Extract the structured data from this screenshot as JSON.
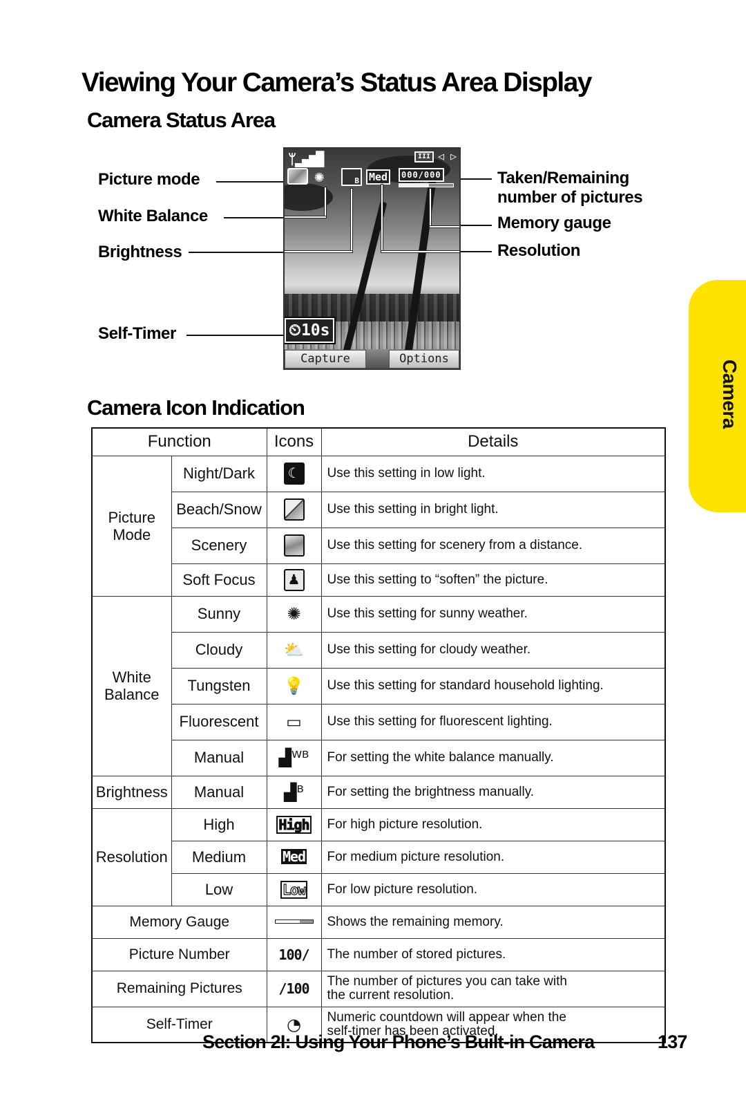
{
  "page": {
    "title": "Viewing Your Camera’s Status Area Display",
    "section_status_heading": "Camera Status Area",
    "section_icons_heading": "Camera Icon Indication",
    "side_tab": "Camera",
    "footer_section": "Section 2I: Using Your Phone’s Built-in Camera",
    "page_number": "137"
  },
  "status_area": {
    "left_callouts": [
      "Picture mode",
      "White Balance",
      "Brightness",
      "Self-Timer"
    ],
    "right_callouts": [
      "Taken/Remaining\nnumber of pictures",
      "Memory gauge",
      "Resolution"
    ],
    "taken_remaining_line1": "Taken/Remaining",
    "taken_remaining_line2": "number of pictures",
    "screen": {
      "signal_icon": "signal-strength-icon",
      "battery_icon": "battery-icon",
      "resolution_badge": "Med",
      "counter": "000/000",
      "timer": "10s",
      "softkey_left": "Capture",
      "softkey_right": "Options"
    }
  },
  "table": {
    "headers": [
      "Function",
      "Icons",
      "Details"
    ],
    "groups": {
      "picture_mode": "Picture\nMode",
      "picture_mode_l1": "Picture",
      "picture_mode_l2": "Mode",
      "white_balance_l1": "White",
      "white_balance_l2": "Balance",
      "brightness": "Brightness",
      "resolution": "Resolution"
    },
    "rows": [
      {
        "function": "Night/Dark",
        "icon": "night-mode-icon",
        "details": "Use this setting in low light."
      },
      {
        "function": "Beach/Snow",
        "icon": "beach-snow-icon",
        "details": "Use this setting in bright light."
      },
      {
        "function": "Scenery",
        "icon": "scenery-icon",
        "details": "Use this setting for scenery from a distance."
      },
      {
        "function": "Soft Focus",
        "icon": "soft-focus-icon",
        "details": "Use this setting to “soften” the picture."
      },
      {
        "function": "Sunny",
        "icon": "sunny-icon",
        "details": "Use this setting for sunny weather."
      },
      {
        "function": "Cloudy",
        "icon": "cloudy-icon",
        "details": "Use this setting for cloudy weather."
      },
      {
        "function": "Tungsten",
        "icon": "tungsten-bulb-icon",
        "details": "Use this setting for standard household lighting."
      },
      {
        "function": "Fluorescent",
        "icon": "fluorescent-icon",
        "details": "Use this setting for fluorescent lighting."
      },
      {
        "function": "Manual",
        "icon": "manual-white-balance-icon",
        "details": "For setting the white balance manually."
      },
      {
        "function": "Manual",
        "icon": "manual-brightness-icon",
        "details": "For setting the brightness manually."
      },
      {
        "function": "High",
        "icon": "high-resolution-icon",
        "icon_text": "High",
        "details": "For high picture resolution."
      },
      {
        "function": "Medium",
        "icon": "medium-resolution-icon",
        "icon_text": "Med",
        "details": "For medium picture resolution."
      },
      {
        "function": "Low",
        "icon": "low-resolution-icon",
        "icon_text": "Low",
        "details": "For low picture resolution."
      },
      {
        "function": "Memory Gauge",
        "icon": "memory-gauge-icon",
        "details": "Shows the remaining memory."
      },
      {
        "function": "Picture Number",
        "icon": "picture-number-icon",
        "icon_text": "100/",
        "details": "The number of stored pictures."
      },
      {
        "function": "Remaining Pictures",
        "icon": "remaining-pictures-icon",
        "icon_text": "/100",
        "details_l1": "The number of pictures you can take with",
        "details_l2": "the current resolution."
      },
      {
        "function": "Self-Timer",
        "icon": "self-timer-icon",
        "details_l1": "Numeric countdown will appear when the",
        "details_l2": "self-timer has been activated."
      }
    ]
  },
  "colors": {
    "side_tab": "#ffe300",
    "text": "#111111"
  }
}
